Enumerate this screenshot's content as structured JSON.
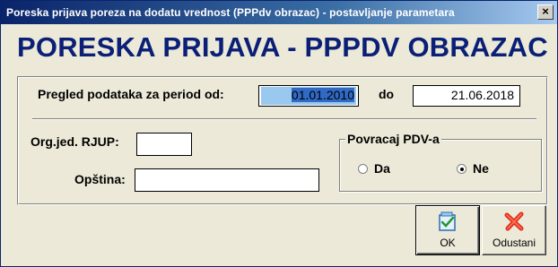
{
  "window": {
    "title": "Poreska prijava poreza na dodatu vrednost (PPPdv obrazac) - postavljanje parametara",
    "close_glyph": "×"
  },
  "heading": "PORESKA PRIJAVA - PPPDV OBRAZAC",
  "period": {
    "label": "Pregled podataka za period od:",
    "from_value": "01.01.2010",
    "to_label": "do",
    "to_value": "21.06.2018"
  },
  "org": {
    "rjup_label": "Org.jed. RJUP:",
    "rjup_value": "",
    "opstina_label": "Opština:",
    "opstina_value": ""
  },
  "povracaj": {
    "legend": "Povracaj PDV-a",
    "options": [
      {
        "label": "Da",
        "selected": false
      },
      {
        "label": "Ne",
        "selected": true
      }
    ]
  },
  "buttons": {
    "ok_label": "OK",
    "ok_icon": "check-document-icon",
    "cancel_label": "Odustani",
    "cancel_icon": "red-x-icon"
  },
  "colors": {
    "title_bar": "#0a246a",
    "heading_text": "#0a1f75",
    "selection": "#316ac5",
    "cancel_icon": "#e0301e"
  }
}
